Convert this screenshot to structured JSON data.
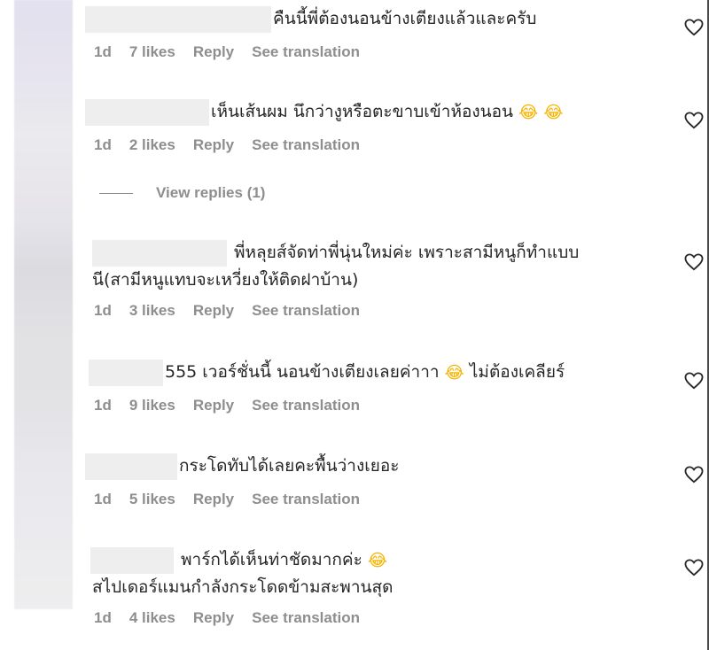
{
  "comments": [
    {
      "lines": [
        {
          "text": "คืนนี้พี่ต้องนอนข้างเตียงแล้วและครับ"
        }
      ],
      "time": "1d",
      "likes": "7 likes",
      "reply": "Reply",
      "translate": "See translation"
    },
    {
      "lines": [
        {
          "text": "เห็นเส้นผม นึกว่างูหรือตะขาบเข้าห้องนอน"
        }
      ],
      "time": "1d",
      "likes": "2 likes",
      "reply": "Reply",
      "translate": "See translation"
    },
    {
      "lines": [
        {
          "text": "พี่หลุยส์จัดท่าพี่นุ่นใหม่ค่ะ เพราะสามีหนูก็ทำแบบ"
        },
        {
          "text": "นี(สามีหนูแทบจะเหวี่ยงให้ติดฝาบ้าน)"
        }
      ],
      "time": "1d",
      "likes": "3 likes",
      "reply": "Reply",
      "translate": "See translation"
    },
    {
      "lines": [
        {
          "text": "555 เวอร์ชั่นนี้ นอนข้างเตียงเลยค่าาา",
          "tail": "ไม่ต้องเคลียร์"
        }
      ],
      "time": "1d",
      "likes": "9 likes",
      "reply": "Reply",
      "translate": "See translation"
    },
    {
      "lines": [
        {
          "text": "กระโดทับได้เลยคะพื้นว่างเยอะ"
        }
      ],
      "time": "1d",
      "likes": "5 likes",
      "reply": "Reply",
      "translate": "See translation"
    },
    {
      "lines": [
        {
          "text": "พาร์กได้เห็นท่าชัดมากค่ะ"
        },
        {
          "text": "สไปเดอร์แมนกำลังกระโดดข้ามสะพานสุด"
        }
      ],
      "time": "1d",
      "likes": "4 likes",
      "reply": "Reply",
      "translate": "See translation"
    }
  ],
  "view_replies": "View replies (1)",
  "icons": {
    "like": "heart-outline-icon",
    "emoji": "laughing-face-emoji"
  },
  "colors": {
    "text": "#262626",
    "meta": "#8e8e8e",
    "redaction": "#eeeeee"
  }
}
